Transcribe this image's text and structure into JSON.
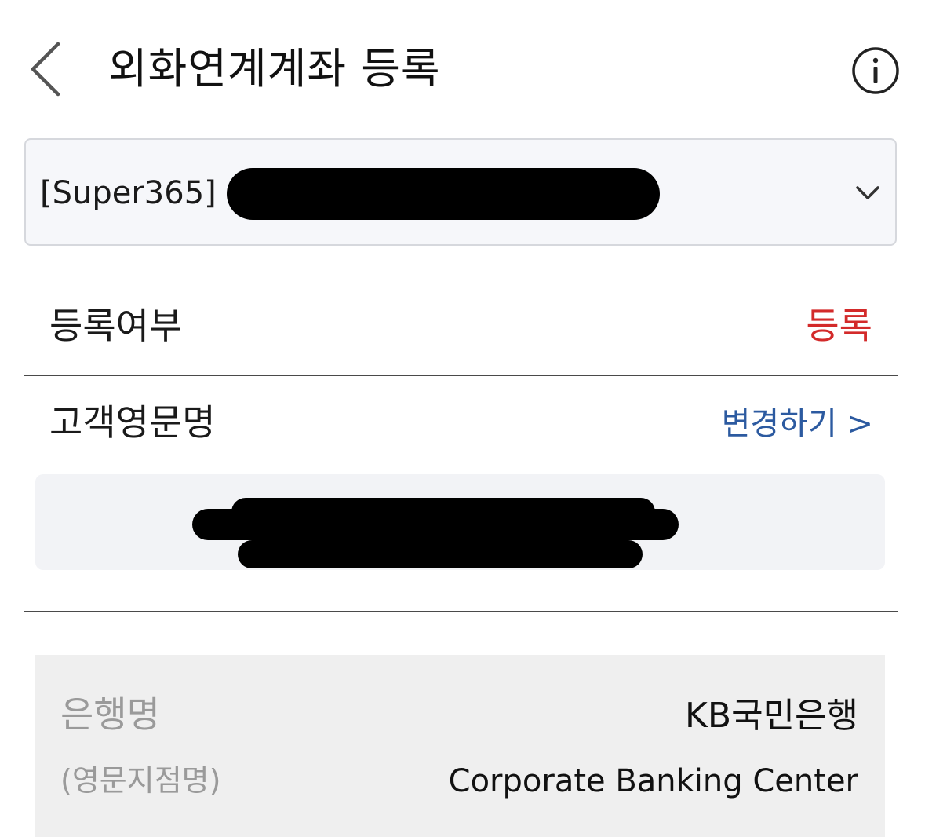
{
  "header": {
    "title": "외화연계계좌 등록",
    "back_icon": "chevron-left-icon",
    "info_icon": "info-circle-icon"
  },
  "account_select": {
    "selected_value": "[Super365]",
    "chevron_icon": "chevron-down-icon"
  },
  "registration": {
    "label": "등록여부",
    "status": "등록",
    "status_color": "#d32a2a"
  },
  "customer_name": {
    "label": "고객영문명",
    "change_link": "변경하기 >",
    "link_color": "#2c5aa0"
  },
  "bank_info": {
    "bank_label": "은행명",
    "bank_value": "KB국민은행",
    "branch_label": "(영문지점명)",
    "branch_value": "Corporate Banking Center"
  }
}
